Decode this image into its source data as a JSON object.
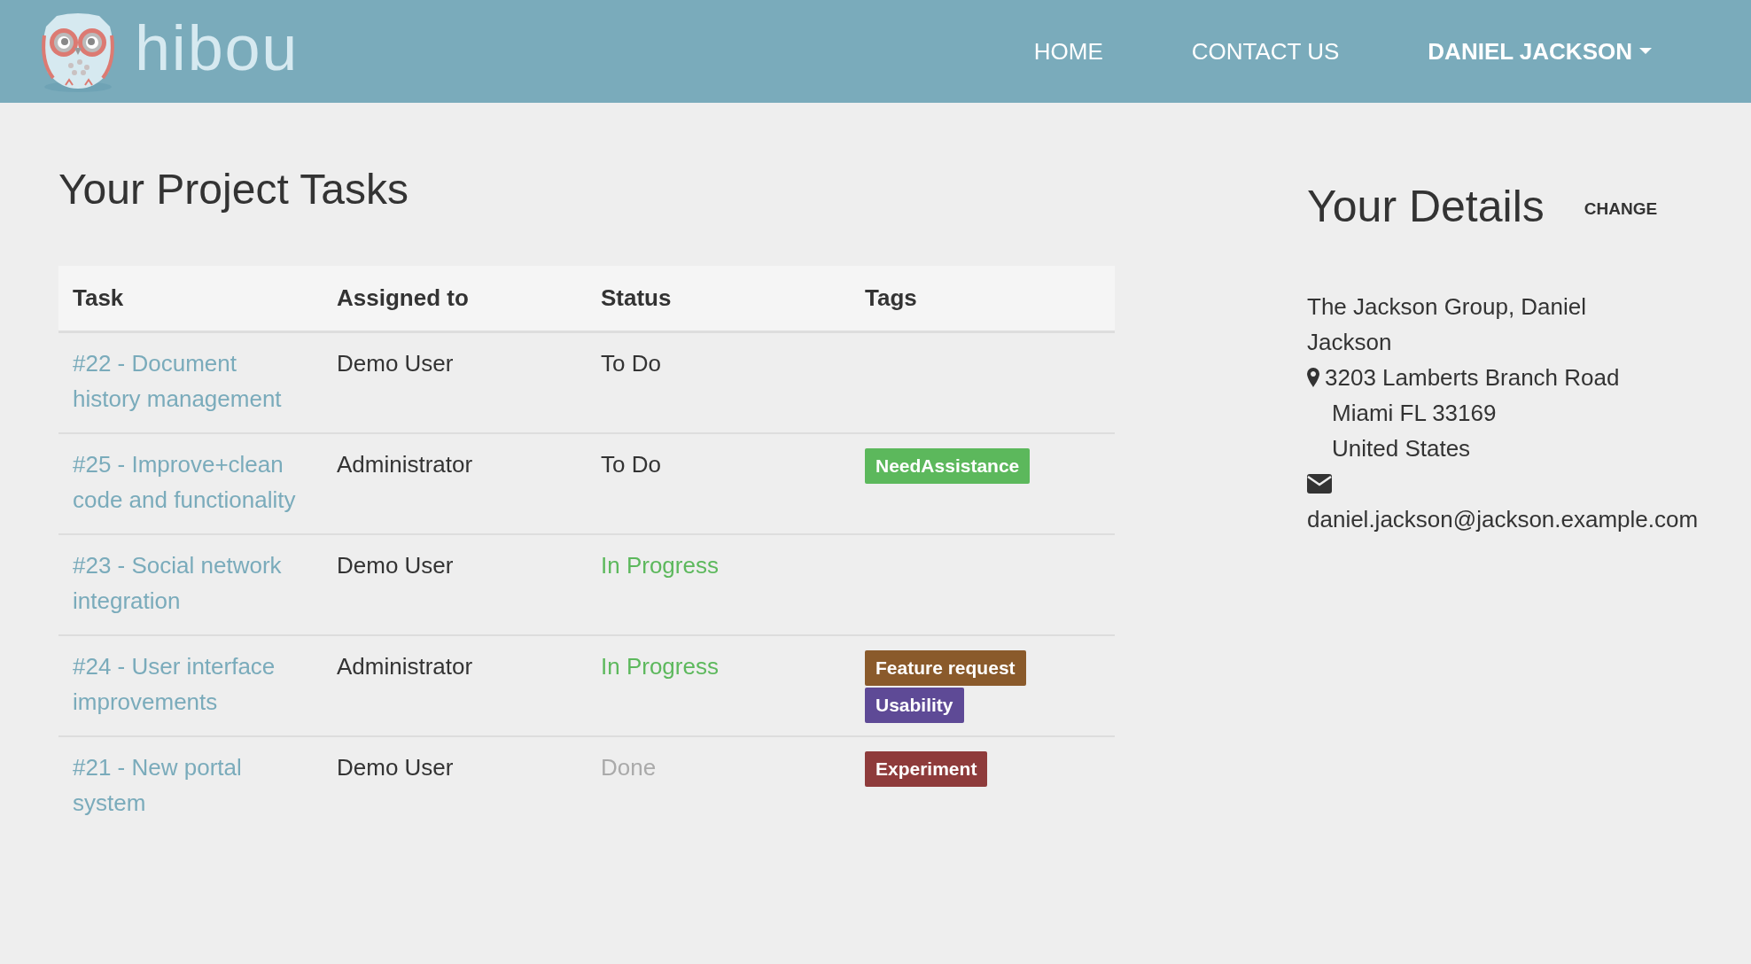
{
  "header": {
    "logo_text": "hibou",
    "nav": [
      {
        "label": "HOME",
        "kind": "link"
      },
      {
        "label": "CONTACT US",
        "kind": "link"
      },
      {
        "label": "DANIEL JACKSON",
        "kind": "dropdown"
      }
    ]
  },
  "tasks": {
    "title": "Your Project Tasks",
    "columns": [
      "Task",
      "Assigned to",
      "Status",
      "Tags"
    ],
    "rows": [
      {
        "task": "#22 - Document history management",
        "assigned": "Demo User",
        "status": {
          "label": "To Do",
          "kind": "todo"
        },
        "tags": []
      },
      {
        "task": "#25 - Improve+clean code and functionality",
        "assigned": "Administrator",
        "status": {
          "label": "To Do",
          "kind": "todo"
        },
        "tags": [
          {
            "label": "NeedAssistance",
            "color": "#5cb85c"
          }
        ]
      },
      {
        "task": "#23 - Social network integration",
        "assigned": "Demo User",
        "status": {
          "label": "In Progress",
          "kind": "in_progress"
        },
        "tags": []
      },
      {
        "task": "#24 - User interface improvements",
        "assigned": "Administrator",
        "status": {
          "label": "In Progress",
          "kind": "in_progress"
        },
        "tags": [
          {
            "label": "Feature request",
            "color": "#8a5a2b"
          },
          {
            "label": "Usability",
            "color": "#5e4a96"
          }
        ]
      },
      {
        "task": "#21 - New portal system",
        "assigned": "Demo User",
        "status": {
          "label": "Done",
          "kind": "done"
        },
        "tags": [
          {
            "label": "Experiment",
            "color": "#8e3b3b"
          }
        ]
      }
    ]
  },
  "details": {
    "title": "Your Details",
    "change": "CHANGE",
    "name": "The Jackson Group, Daniel Jackson",
    "address": [
      "3203 Lamberts Branch Road",
      "Miami FL 33169",
      "United States"
    ],
    "email": "daniel.jackson@jackson.example.com"
  }
}
